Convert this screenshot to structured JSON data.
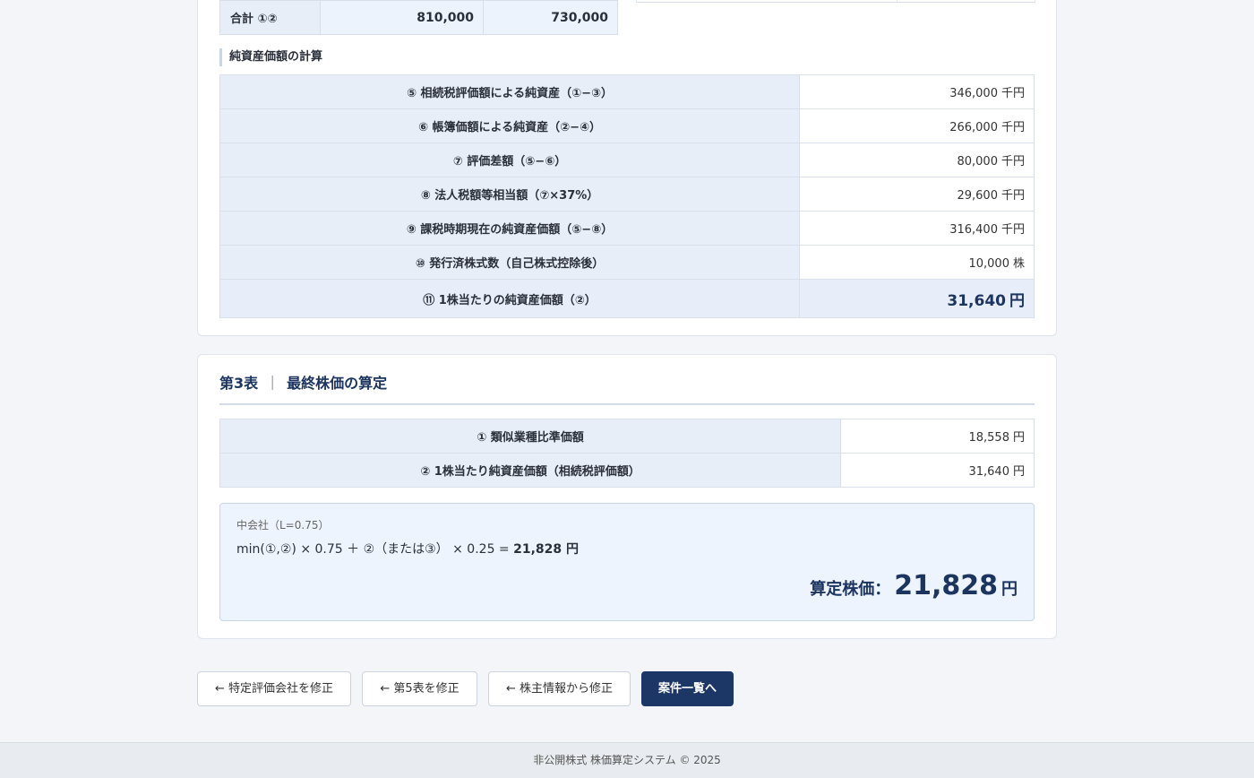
{
  "totals": {
    "label": "合計 ①②",
    "value1": "810,000",
    "value2": "730,000"
  },
  "net_asset_calc": {
    "heading": "純資産価額の計算",
    "rows": [
      {
        "label": "⑤ 相続税評価額による純資産（①−③）",
        "value": "346,000",
        "unit": "千円"
      },
      {
        "label": "⑥ 帳簿価額による純資産（②−④）",
        "value": "266,000",
        "unit": "千円"
      },
      {
        "label": "⑦ 評価差額（⑤−⑥）",
        "value": "80,000",
        "unit": "千円"
      },
      {
        "label": "⑧ 法人税額等相当額（⑦×37%）",
        "value": "29,600",
        "unit": "千円"
      },
      {
        "label": "⑨ 課税時期現在の純資産価額（⑤−⑧）",
        "value": "316,400",
        "unit": "千円"
      },
      {
        "label": "⑩ 発行済株式数（自己株式控除後）",
        "value": "10,000",
        "unit": "株"
      }
    ],
    "final": {
      "label": "⑪ 1株当たりの純資産価額（②）",
      "value": "31,640",
      "unit": "円"
    }
  },
  "table3": {
    "title_prefix": "第3表",
    "separator": "｜",
    "title": "最終株価の算定",
    "rows": [
      {
        "label": "① 類似業種比準価額",
        "value": "18,558",
        "unit": "円"
      },
      {
        "label": "② 1株当たり純資産価額（相続税評価額）",
        "value": "31,640",
        "unit": "円"
      }
    ],
    "company_size": "中会社（L=0.75）",
    "formula": "min(①,②) × 0.75 ＋ ②（または③） × 0.25 = ",
    "formula_result": "21,828 円",
    "final_label": "算定株価：",
    "final_value": "21,828",
    "final_unit": "円"
  },
  "buttons": {
    "edit_specific": "← 特定評価会社を修正",
    "edit_table5": "← 第5表を修正",
    "edit_shareholder": "← 株主情報から修正",
    "case_list": "案件一覧へ"
  },
  "footer": "非公開株式 株価算定システム © 2025"
}
